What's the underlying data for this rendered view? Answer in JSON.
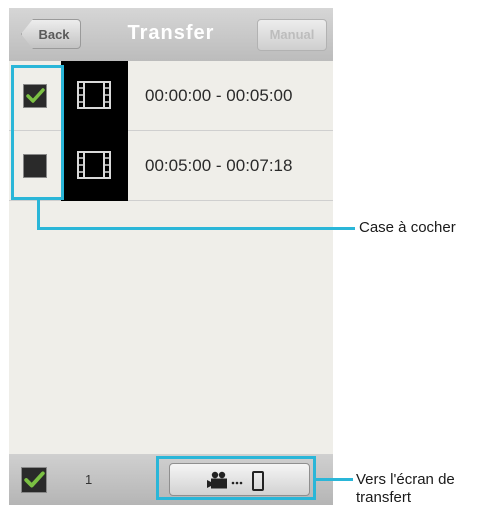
{
  "header": {
    "back_label": "Back",
    "title": "Transfer",
    "manual_label": "Manual"
  },
  "clips": [
    {
      "checked": true,
      "time_range": "00:00:00 - 00:05:00"
    },
    {
      "checked": false,
      "time_range": "00:05:00 - 00:07:18"
    }
  ],
  "footer": {
    "select_all_checked": true,
    "selected_count": "1"
  },
  "callouts": {
    "checkbox_label": "Case à cocher",
    "transfer_label_line1": "Vers l'écran de",
    "transfer_label_line2": "transfert"
  },
  "icons": {
    "check": "check-icon",
    "film": "film-strip-icon",
    "camera": "video-camera-icon",
    "phone": "smartphone-icon"
  },
  "colors": {
    "highlight": "#2ab6d8",
    "check": "#7bc043",
    "header_title": "#ffffff"
  }
}
